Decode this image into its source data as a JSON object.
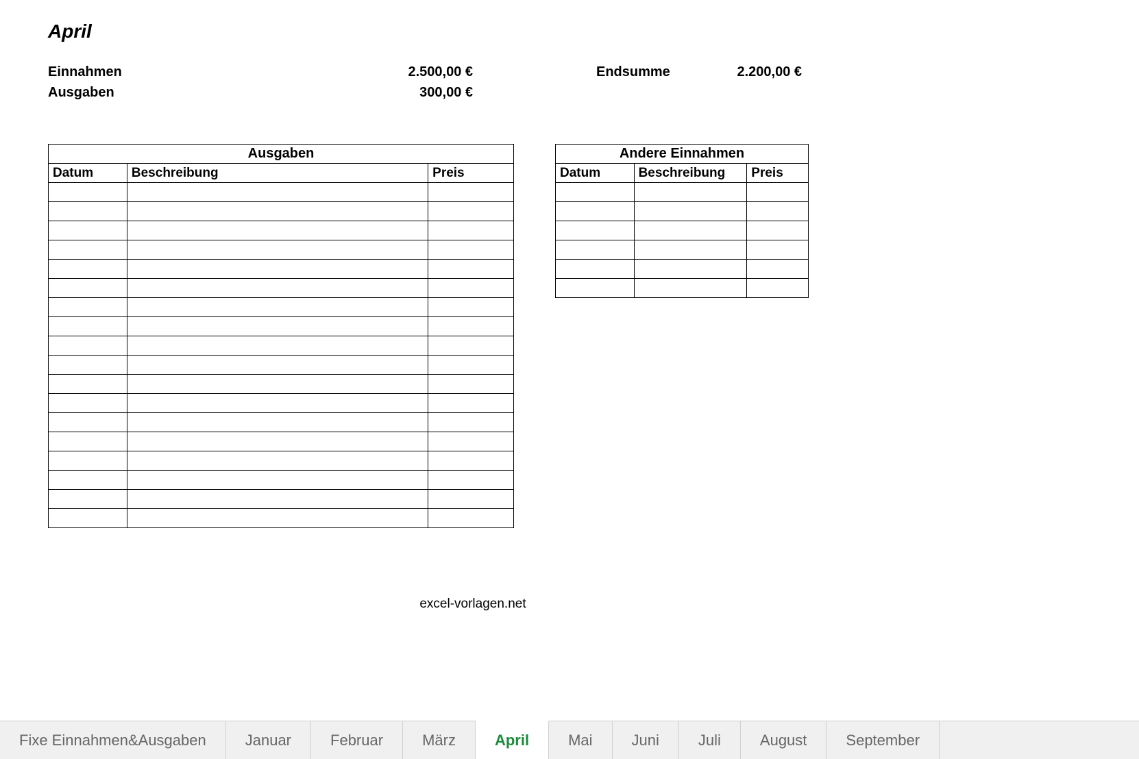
{
  "title": "April",
  "summary": {
    "income_label": "Einnahmen",
    "income_value": "2.500,00 €",
    "expense_label": "Ausgaben",
    "expense_value": "300,00 €",
    "total_label": "Endsumme",
    "total_value": "2.200,00 €"
  },
  "expenses_table": {
    "title": "Ausgaben",
    "col_date": "Datum",
    "col_desc": "Beschreibung",
    "col_price": "Preis",
    "rows": [
      "",
      "",
      "",
      "",
      "",
      "",
      "",
      "",
      "",
      "",
      "",
      "",
      "",
      "",
      "",
      "",
      "",
      ""
    ]
  },
  "income_table": {
    "title": "Andere Einnahmen",
    "col_date": "Datum",
    "col_desc": "Beschreibung",
    "col_price": "Preis",
    "rows": [
      "",
      "",
      "",
      "",
      "",
      ""
    ]
  },
  "footer": "excel-vorlagen.net",
  "tabs": [
    {
      "label": "Fixe Einnahmen&Ausgaben",
      "active": false
    },
    {
      "label": "Januar",
      "active": false
    },
    {
      "label": "Februar",
      "active": false
    },
    {
      "label": "März",
      "active": false
    },
    {
      "label": "April",
      "active": true
    },
    {
      "label": "Mai",
      "active": false
    },
    {
      "label": "Juni",
      "active": false
    },
    {
      "label": "Juli",
      "active": false
    },
    {
      "label": "August",
      "active": false
    },
    {
      "label": "September",
      "active": false
    }
  ]
}
